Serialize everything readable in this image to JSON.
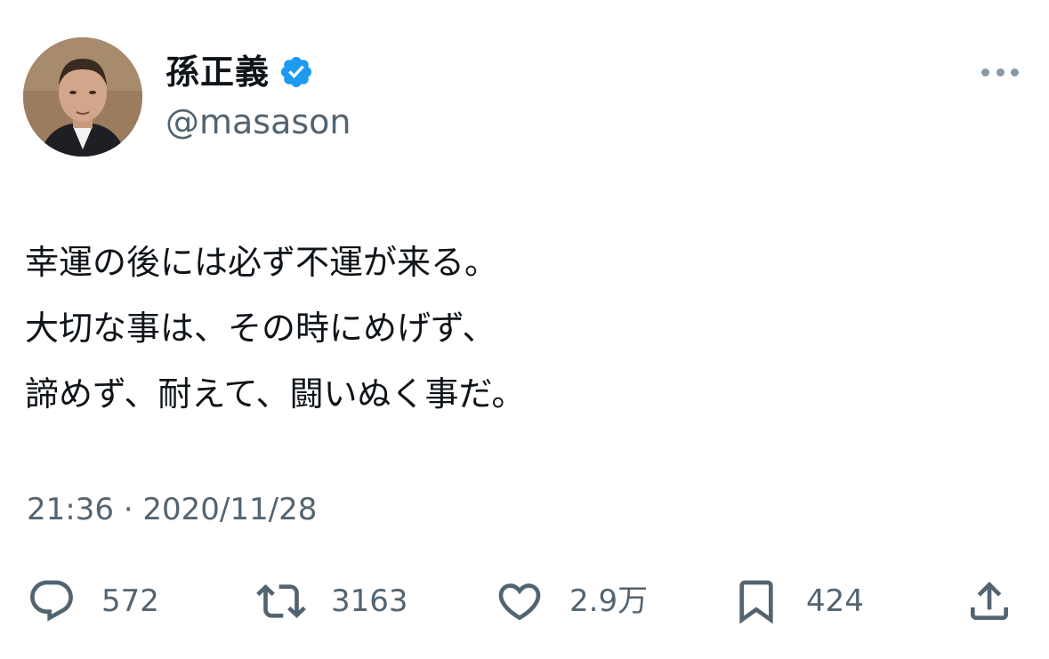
{
  "author": {
    "display_name": "孫正義",
    "handle": "@masason",
    "verified_badge_icon": "verified-check-icon",
    "verified_color": "#1d9bf0"
  },
  "tweet": {
    "lines": [
      "幸運の後には必ず不運が来る。",
      "大切な事は、その時にめげず、",
      "諦めず、耐えて、闘いぬく事だ。"
    ],
    "timestamp": "21:36 · 2020/11/28"
  },
  "actions": {
    "reply": {
      "icon": "reply-icon",
      "count": "572"
    },
    "retweet": {
      "icon": "retweet-icon",
      "count": "3163"
    },
    "like": {
      "icon": "heart-icon",
      "count": "2.9万"
    },
    "bookmark": {
      "icon": "bookmark-icon",
      "count": "424"
    },
    "share": {
      "icon": "share-icon"
    }
  },
  "menu": {
    "icon": "more-options-icon"
  },
  "colors": {
    "text": "#0f1419",
    "secondary_text": "#536471",
    "icon": "#536471",
    "more_dots": "#8b98a5",
    "background": "#ffffff"
  }
}
